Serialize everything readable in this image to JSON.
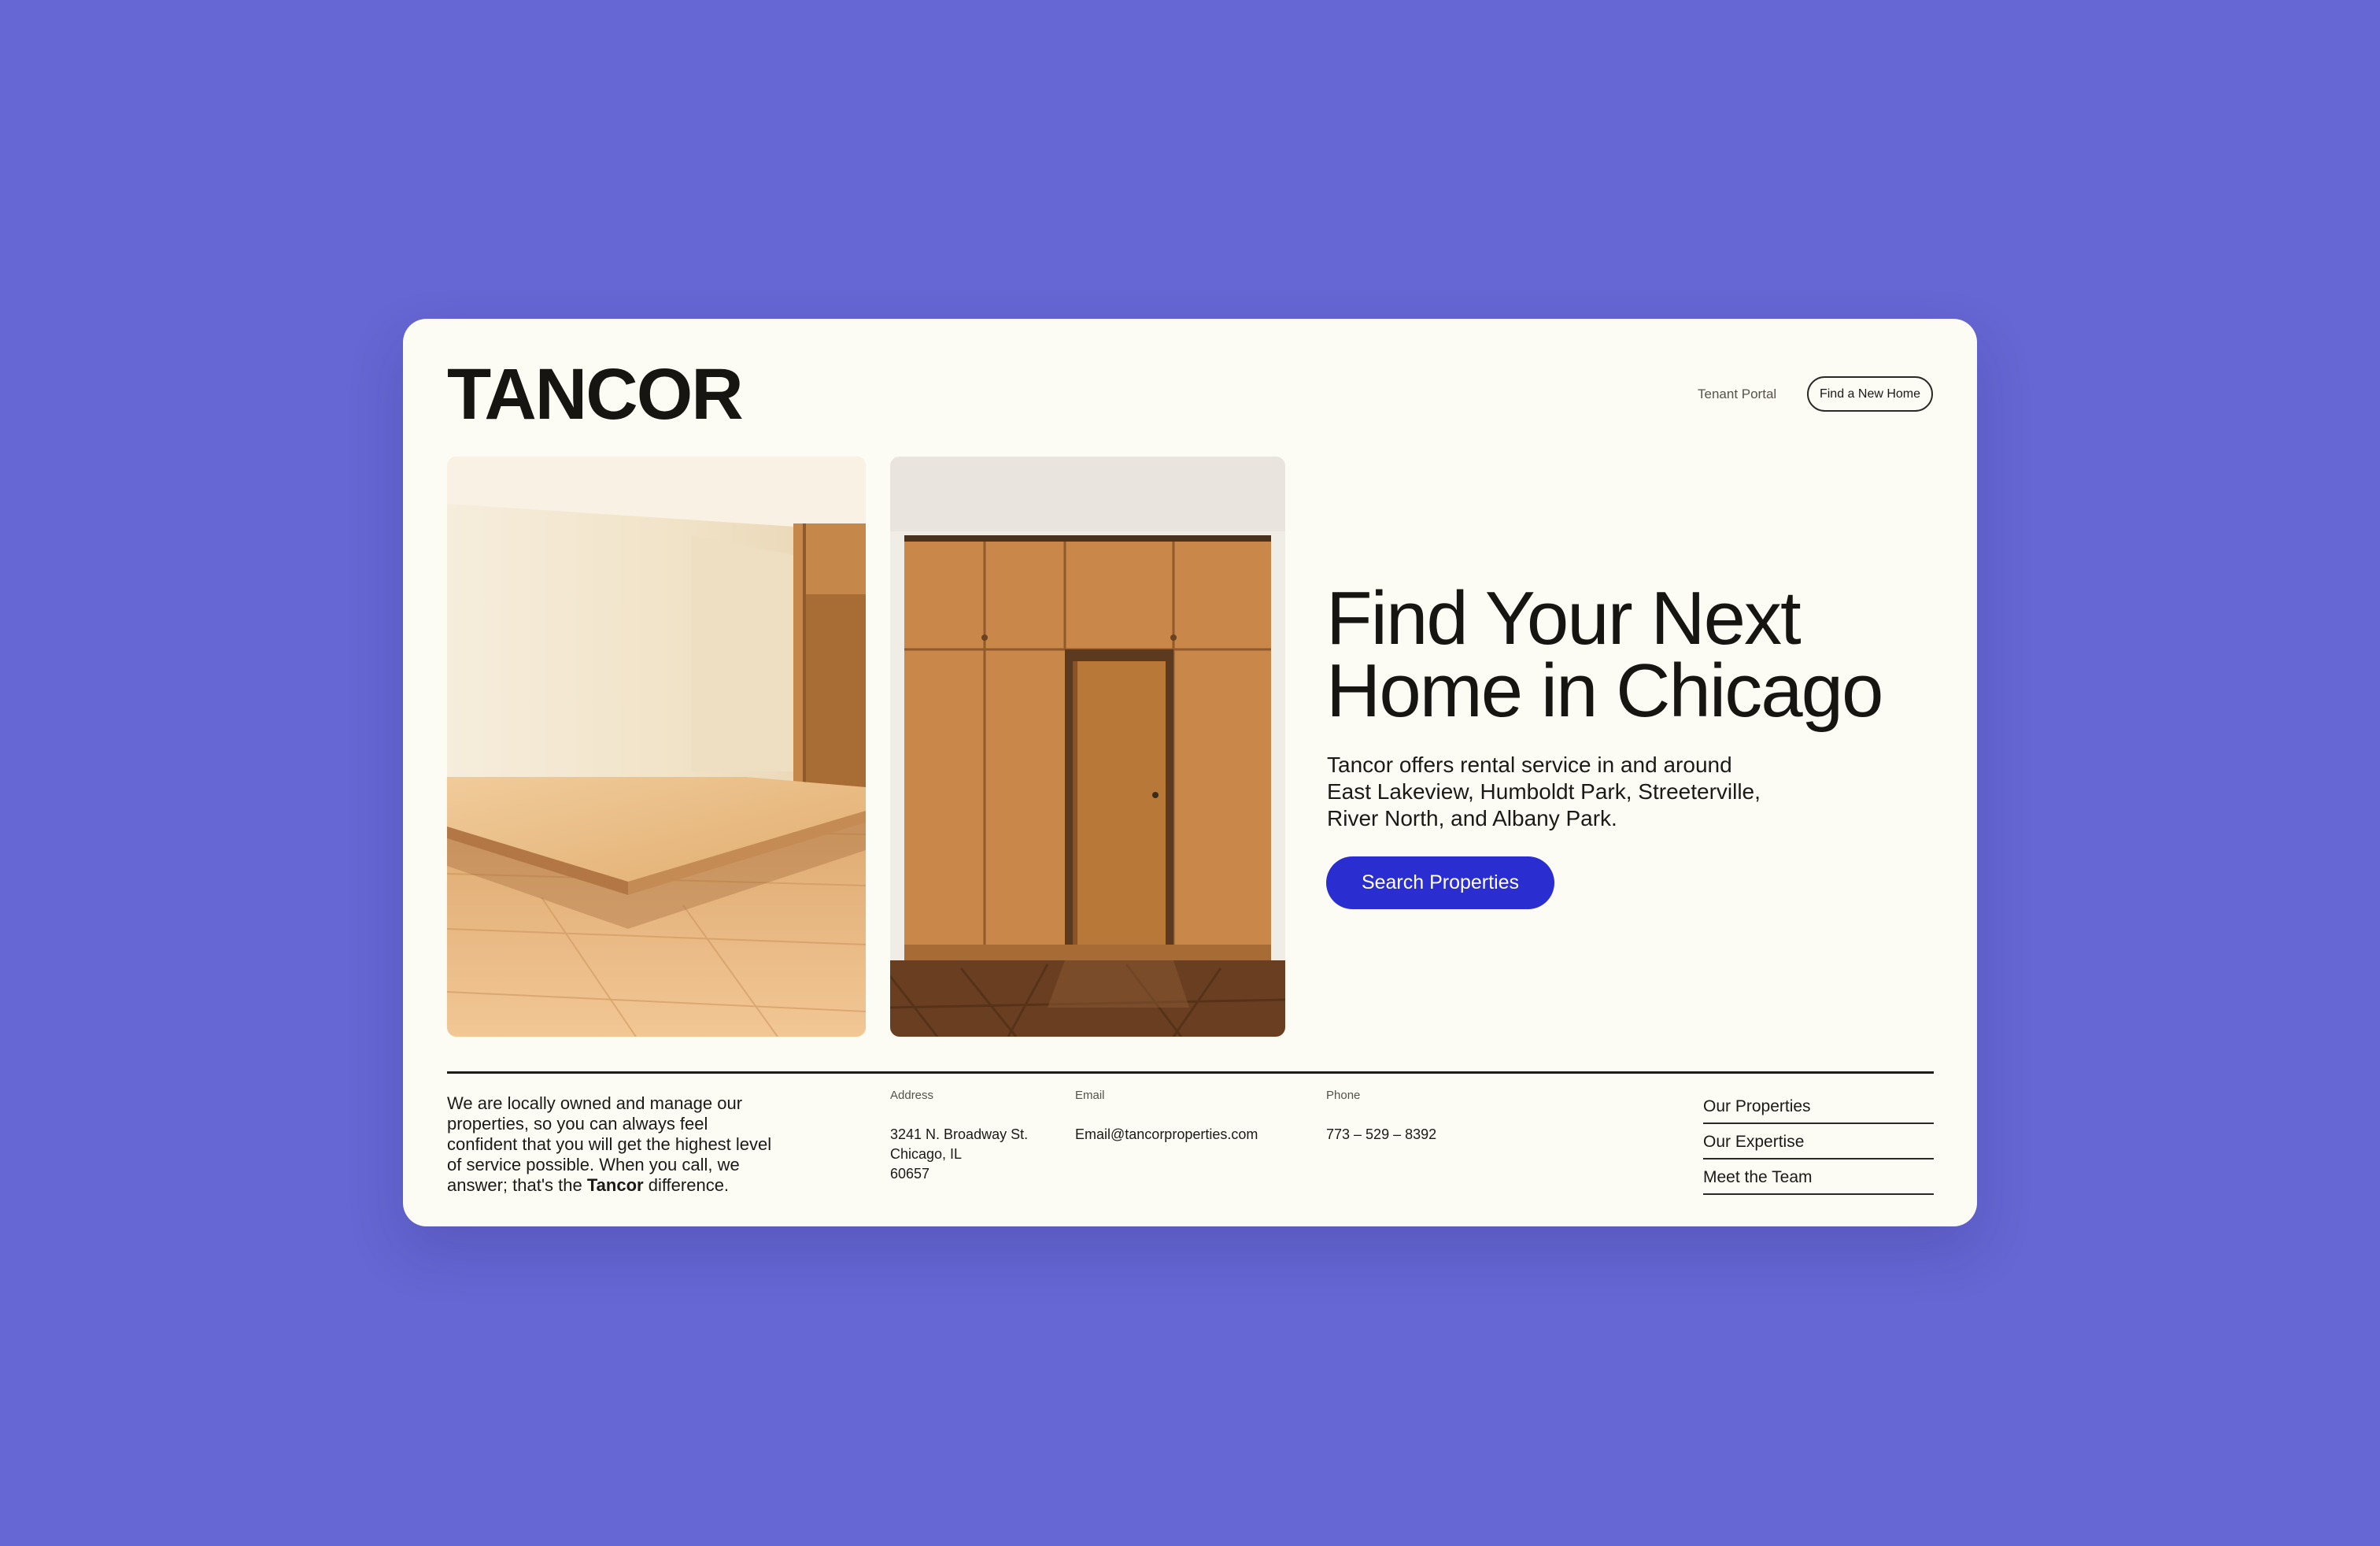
{
  "brand": {
    "logo": "TANCOR"
  },
  "header": {
    "tenant_portal": "Tenant Portal",
    "find_home_button": "Find a New Home"
  },
  "hero": {
    "headline_line1": "Find Your Next",
    "headline_line2": "Home in Chicago",
    "intro_line1": "Tancor offers rental service in and around",
    "intro_line2": "East Lakeview, Humboldt Park, Streeterville,",
    "intro_line3": "River North, and Albany Park.",
    "cta_label": "Search Properties"
  },
  "footer": {
    "about_text": "We are locally owned and manage our properties, so you can always feel confident that you will get the highest level of service possible. When you call, we answer; that's the",
    "about_brand": "Tancor",
    "about_end": "difference.",
    "address_label": "Address",
    "address_line1": "3241 N. Broadway St.",
    "address_line2": "Chicago, IL",
    "address_line3": "60657",
    "email_label": "Email",
    "email_value": "Email@tancorproperties.com",
    "phone_label": "Phone",
    "phone_value": "773 – 529 – 8392",
    "nav": [
      "Our Properties",
      "Our Expertise",
      "Meet the Team"
    ]
  },
  "colors": {
    "background": "#6666d4",
    "card": "#fcfbf4",
    "accent": "#2a2ed0",
    "text": "#1b1a17"
  }
}
